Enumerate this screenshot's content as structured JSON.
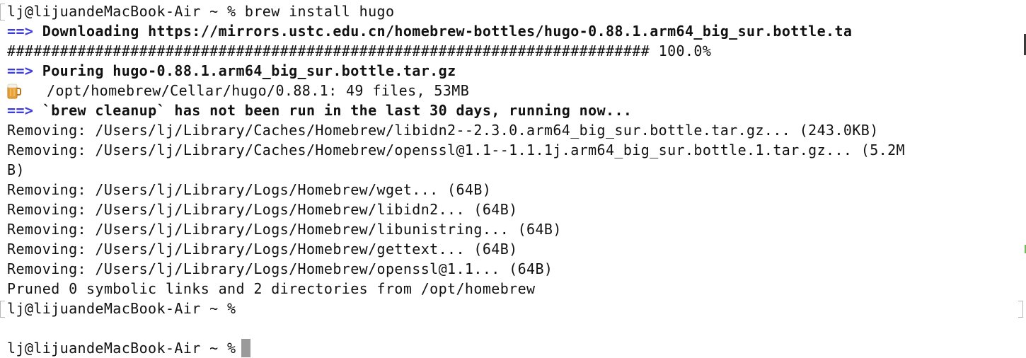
{
  "terminal": {
    "lines": [
      {
        "text": "lj@lijuandeMacBook-Air ~ % brew install hugo"
      },
      {
        "arrow": "==>",
        "text": "Downloading https://mirrors.ustc.edu.cn/homebrew-bottles/hugo-0.88.1.arm64_big_sur.bottle.ta"
      },
      {
        "text": "######################################################################### 100.0%"
      },
      {
        "arrow": "==>",
        "text": "Pouring hugo-0.88.1.arm64_big_sur.bottle.tar.gz"
      },
      {
        "icon": "beer-mug-icon",
        "text": "/opt/homebrew/Cellar/hugo/0.88.1: 49 files, 53MB"
      },
      {
        "arrow": "==>",
        "text": "`brew cleanup` has not been run in the last 30 days, running now..."
      },
      {
        "text": "Removing: /Users/lj/Library/Caches/Homebrew/libidn2--2.3.0.arm64_big_sur.bottle.tar.gz... (243.0KB)"
      },
      {
        "text": "Removing: /Users/lj/Library/Caches/Homebrew/openssl@1.1--1.1.1j.arm64_big_sur.bottle.1.tar.gz... (5.2M"
      },
      {
        "text": "B)"
      },
      {
        "text": "Removing: /Users/lj/Library/Logs/Homebrew/wget... (64B)"
      },
      {
        "text": "Removing: /Users/lj/Library/Logs/Homebrew/libidn2... (64B)"
      },
      {
        "text": "Removing: /Users/lj/Library/Logs/Homebrew/libunistring... (64B)"
      },
      {
        "text": "Removing: /Users/lj/Library/Logs/Homebrew/gettext... (64B)"
      },
      {
        "text": "Removing: /Users/lj/Library/Logs/Homebrew/openssl@1.1... (64B)"
      },
      {
        "text": "Pruned 0 symbolic links and 2 directories from /opt/homebrew"
      },
      {
        "text": "lj@lijuandeMacBook-Air ~ %"
      },
      {
        "text": ""
      },
      {
        "text": "lj@lijuandeMacBook-Air ~ %"
      }
    ]
  },
  "colors": {
    "arrow": "#3d3ddb",
    "text": "#111111",
    "cursor": "#9a9a9a",
    "background": "#ffffff"
  }
}
